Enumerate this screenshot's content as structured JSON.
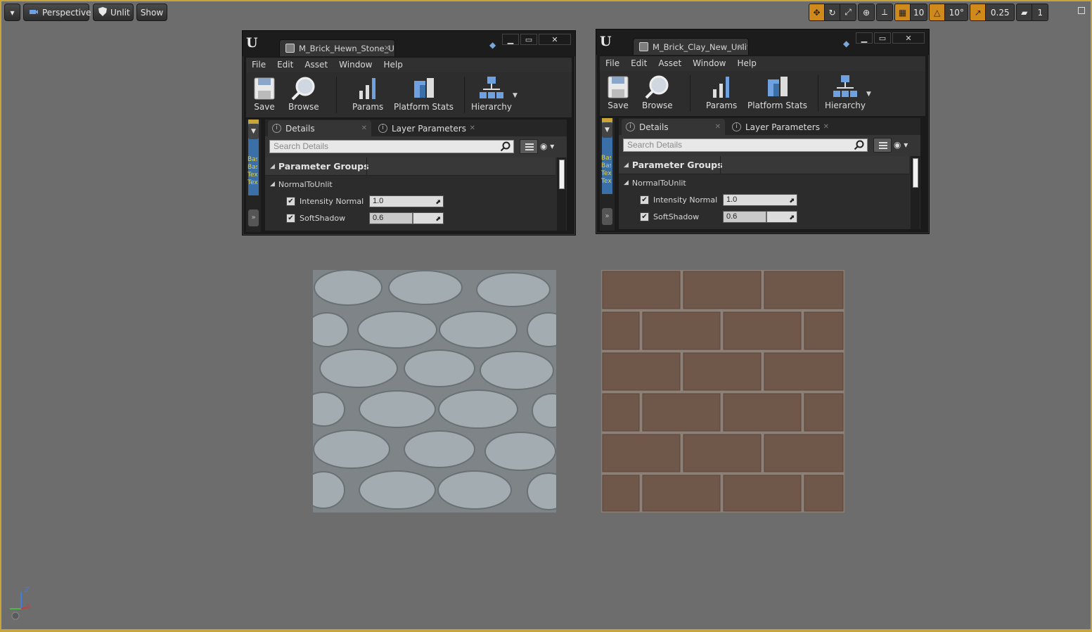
{
  "viewport": {
    "menu_dropdown": "▾",
    "perspective": "Perspective",
    "unlit": "Unlit",
    "show": "Show",
    "grid_snap": "10",
    "rotation_snap": "10°",
    "scale_snap": "0.25",
    "camera_speed": "1",
    "accent_color": "#d08a1c",
    "border_color": "#c8a53a"
  },
  "windows": [
    {
      "tab_title": "M_Brick_Hewn_Stone_Un",
      "menus": [
        "File",
        "Edit",
        "Asset",
        "Window",
        "Help"
      ],
      "toolbar": {
        "save": "Save",
        "browse": "Browse",
        "params": "Params",
        "platform_stats": "Platform Stats",
        "hierarchy": "Hierarchy"
      },
      "tabs": {
        "details": "Details",
        "layer_parameters": "Layer Parameters"
      },
      "search_placeholder": "Search Details",
      "parameter_groups": "Parameter Groups",
      "group": "NormalToUnlit",
      "params": [
        {
          "label": "Intensity Normal",
          "value": "1.0",
          "fill": 0.0,
          "checked": true
        },
        {
          "label": "SoftShadow",
          "value": "0.6",
          "fill": 0.6,
          "checked": true
        }
      ]
    },
    {
      "tab_title": "M_Brick_Clay_New_Unlit_I",
      "menus": [
        "File",
        "Edit",
        "Asset",
        "Window",
        "Help"
      ],
      "toolbar": {
        "save": "Save",
        "browse": "Browse",
        "params": "Params",
        "platform_stats": "Platform Stats",
        "hierarchy": "Hierarchy"
      },
      "tabs": {
        "details": "Details",
        "layer_parameters": "Layer Parameters"
      },
      "search_placeholder": "Search Details",
      "parameter_groups": "Parameter Groups",
      "group": "NormalToUnlit",
      "params": [
        {
          "label": "Intensity Normal",
          "value": "1.0",
          "fill": 0.0,
          "checked": true
        },
        {
          "label": "SoftShadow",
          "value": "0.6",
          "fill": 0.6,
          "checked": true
        }
      ]
    }
  ],
  "sidebar_text": "Bas Bas Tex Tex",
  "axis": {
    "z": "Z",
    "x": "X"
  },
  "swatches": {
    "stone_color": "#8d959a",
    "brick_color": "#6b5548"
  }
}
